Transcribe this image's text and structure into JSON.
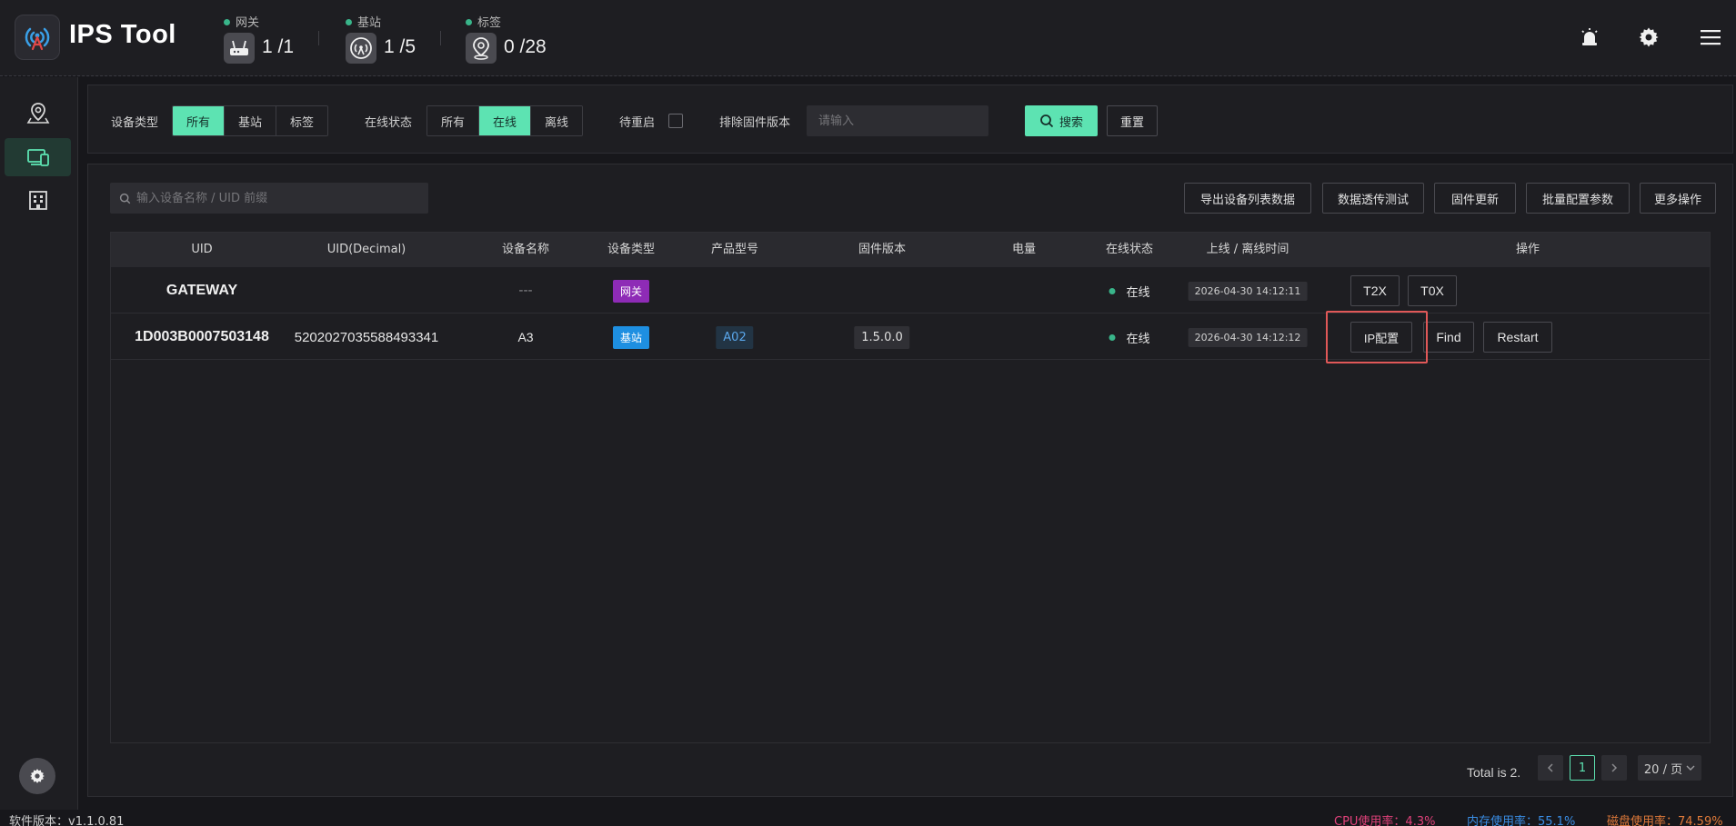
{
  "app": {
    "title": "IPS Tool"
  },
  "header_stats": [
    {
      "label": "网关",
      "value": "1 /1",
      "icon": "router-icon"
    },
    {
      "label": "基站",
      "value": "1 /5",
      "icon": "antenna-icon"
    },
    {
      "label": "标签",
      "value": "0 /28",
      "icon": "location-pin-icon"
    }
  ],
  "header_icons": [
    "alarm-light-icon",
    "gear-icon",
    "hamburger-menu-icon"
  ],
  "sidebar": {
    "items": [
      {
        "icon": "map-pin-icon",
        "active": false
      },
      {
        "icon": "devices-icon",
        "active": true
      },
      {
        "icon": "building-icon",
        "active": false
      }
    ],
    "bottom_icon": "gear-icon"
  },
  "filters": {
    "device_type": {
      "label": "设备类型",
      "options": [
        "所有",
        "基站",
        "标签"
      ],
      "selected": "所有"
    },
    "online_status": {
      "label": "在线状态",
      "options": [
        "所有",
        "在线",
        "离线"
      ],
      "selected": "在线"
    },
    "pending_restart": {
      "label": "待重启",
      "checked": false
    },
    "exclude_firmware": {
      "label": "排除固件版本",
      "placeholder": "请输入",
      "value": ""
    },
    "search_button": "搜索",
    "reset_button": "重置"
  },
  "toolbar": {
    "search_placeholder": "输入设备名称 / UID 前缀",
    "buttons": [
      "导出设备列表数据",
      "数据透传测试",
      "固件更新",
      "批量配置参数",
      "更多操作"
    ]
  },
  "table": {
    "columns": [
      "UID",
      "UID(Decimal)",
      "设备名称",
      "设备类型",
      "产品型号",
      "固件版本",
      "电量",
      "在线状态",
      "上线 / 离线时间",
      "操作"
    ],
    "rows": [
      {
        "uid": "GATEWAY",
        "uid_decimal": "",
        "name": "---",
        "type": "网关",
        "model": "",
        "firmware": "",
        "battery": "",
        "status": "在线",
        "time": "2026-04-30 14:12:11",
        "actions": [
          "T2X",
          "T0X"
        ]
      },
      {
        "uid": "1D003B0007503148",
        "uid_decimal": "5202027035588493341",
        "name": "A3",
        "type": "基站",
        "model": "A02",
        "firmware": "1.5.0.0",
        "battery": "",
        "status": "在线",
        "time": "2026-04-30 14:12:12",
        "actions": [
          "IP配置",
          "Find",
          "Restart"
        ]
      }
    ]
  },
  "pagination": {
    "total_text": "Total is 2.",
    "current_page": "1",
    "page_size": "20 / 页"
  },
  "footer": {
    "version": "软件版本：v1.1.0.81",
    "cpu": "CPU使用率：4.3%",
    "memory": "内存使用率：55.1%",
    "disk": "磁盘使用率：74.59%"
  },
  "colors": {
    "accent": "#5de3b2",
    "online": "#39b58a",
    "gateway_tag": "#8e2bb6",
    "station_tag": "#1e8fe1",
    "highlight": "#e05858",
    "cpu": "#e0417a",
    "memory": "#3a8ee6",
    "disk": "#e07a3a"
  }
}
